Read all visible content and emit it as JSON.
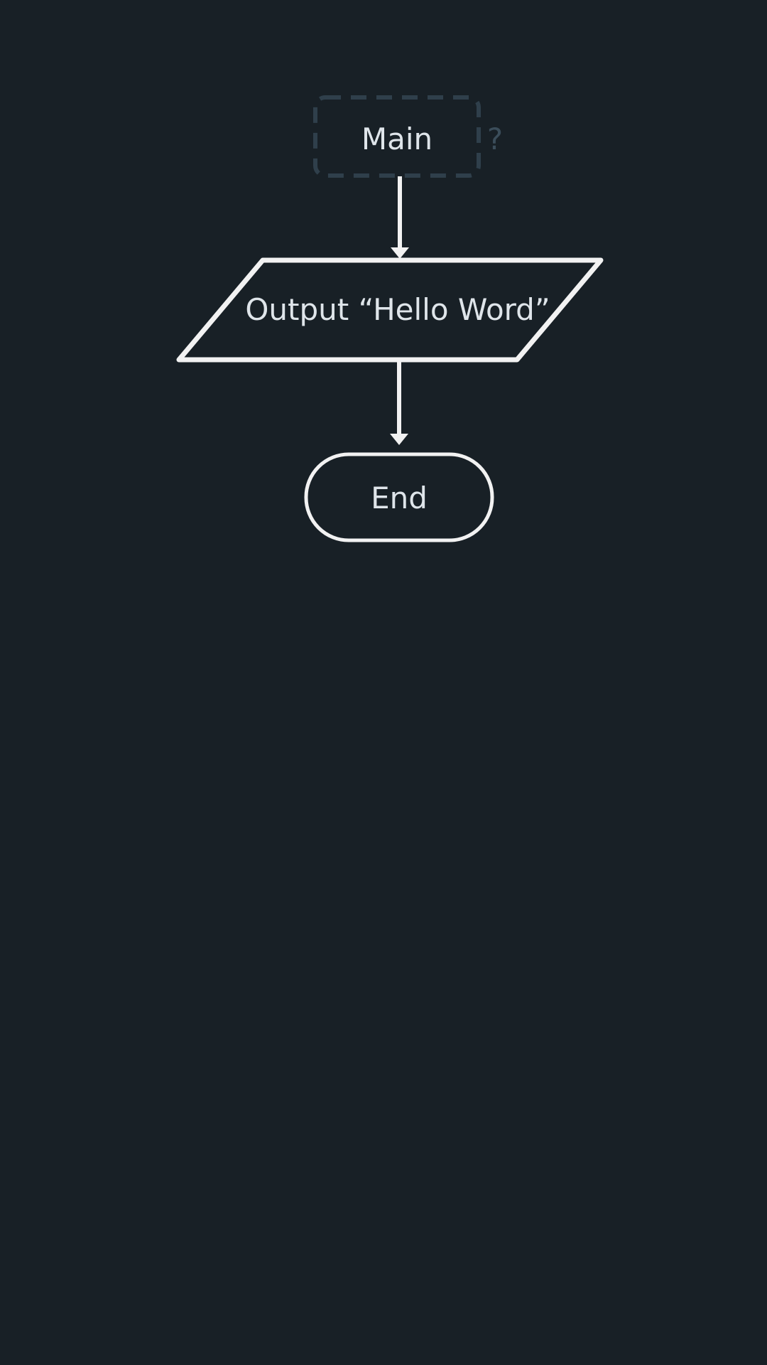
{
  "diagram": {
    "start_label": "Main",
    "start_help": "?",
    "output_label": "Output “Hello Word”",
    "end_label": "End"
  },
  "colors": {
    "background": "#182026",
    "start_border": "#2f3f4b",
    "stroke": "#f2f2f2",
    "text": "#dfe5ea",
    "help": "#3b4d5a"
  }
}
